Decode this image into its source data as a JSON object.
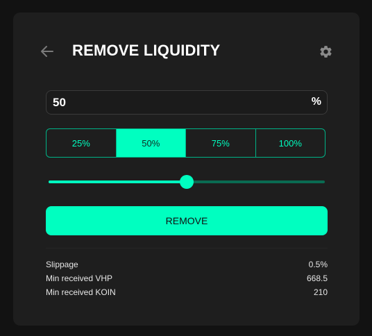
{
  "header": {
    "title": "REMOVE LIQUIDITY",
    "back_icon": "arrow-left-icon",
    "settings_icon": "gear-icon"
  },
  "amount_input": {
    "value": "50",
    "unit": "%"
  },
  "presets": [
    {
      "label": "25%",
      "active": false
    },
    {
      "label": "50%",
      "active": true
    },
    {
      "label": "75%",
      "active": false
    },
    {
      "label": "100%",
      "active": false
    }
  ],
  "slider": {
    "value_percent": 50
  },
  "remove_button": {
    "label": "REMOVE"
  },
  "details": [
    {
      "label": "Slippage",
      "value": "0.5%"
    },
    {
      "label": "Min received VHP",
      "value": "668.5"
    },
    {
      "label": "Min received KOIN",
      "value": "210"
    }
  ],
  "colors": {
    "accent": "#00ffc0",
    "card_bg": "#1e1e1e",
    "page_bg": "#121212",
    "track_inactive": "#0a6b52"
  }
}
